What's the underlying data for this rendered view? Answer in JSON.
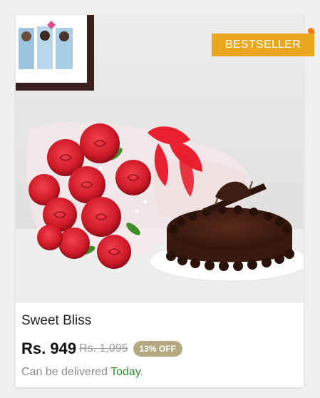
{
  "product": {
    "image_alt": "Red roses bouquet with chocolate cake",
    "badge": "BESTSELLER",
    "name": "Sweet Bliss",
    "price": "Rs. 949",
    "mrp": "Rs. 1,095",
    "discount": "13% OFF",
    "delivery_prefix": "Can be delivered",
    "delivery_day": "Today",
    "delivery_suffix": "."
  },
  "colors": {
    "badge_bg": "#e8a71c",
    "badge_tab": "#f07b18",
    "discount_bg": "#b3a87f",
    "delivery_day": "#2e8b2e"
  }
}
